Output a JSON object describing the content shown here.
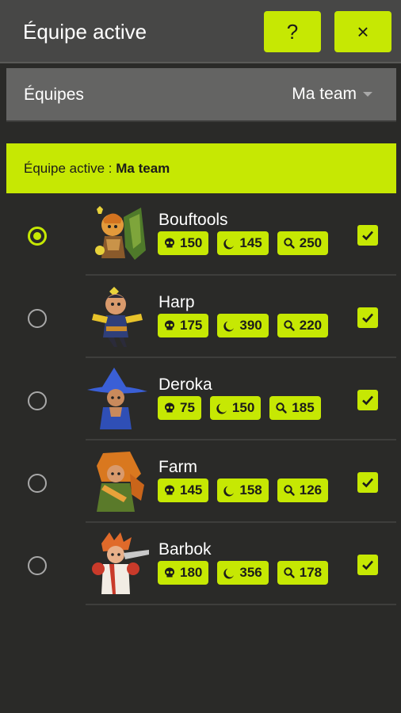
{
  "header": {
    "title": "Équipe active",
    "help_label": "?",
    "close_label": "×"
  },
  "team_selector": {
    "label": "Équipes",
    "value": "Ma team"
  },
  "active_banner": {
    "prefix": "Équipe active : ",
    "team": "Ma team"
  },
  "colors": {
    "accent": "#c6e803",
    "background": "#2a2a28",
    "header": "#474746",
    "selector": "#646463"
  },
  "characters": [
    {
      "name": "Bouftools",
      "stats": {
        "skull": "150",
        "moon": "145",
        "search": "250"
      },
      "active": true,
      "checked": true
    },
    {
      "name": "Harp",
      "stats": {
        "skull": "175",
        "moon": "390",
        "search": "220"
      },
      "active": false,
      "checked": true
    },
    {
      "name": "Deroka",
      "stats": {
        "skull": "75",
        "moon": "150",
        "search": "185"
      },
      "active": false,
      "checked": true
    },
    {
      "name": "Farm",
      "stats": {
        "skull": "145",
        "moon": "158",
        "search": "126"
      },
      "active": false,
      "checked": true
    },
    {
      "name": "Barbok",
      "stats": {
        "skull": "180",
        "moon": "356",
        "search": "178"
      },
      "active": false,
      "checked": true
    }
  ]
}
